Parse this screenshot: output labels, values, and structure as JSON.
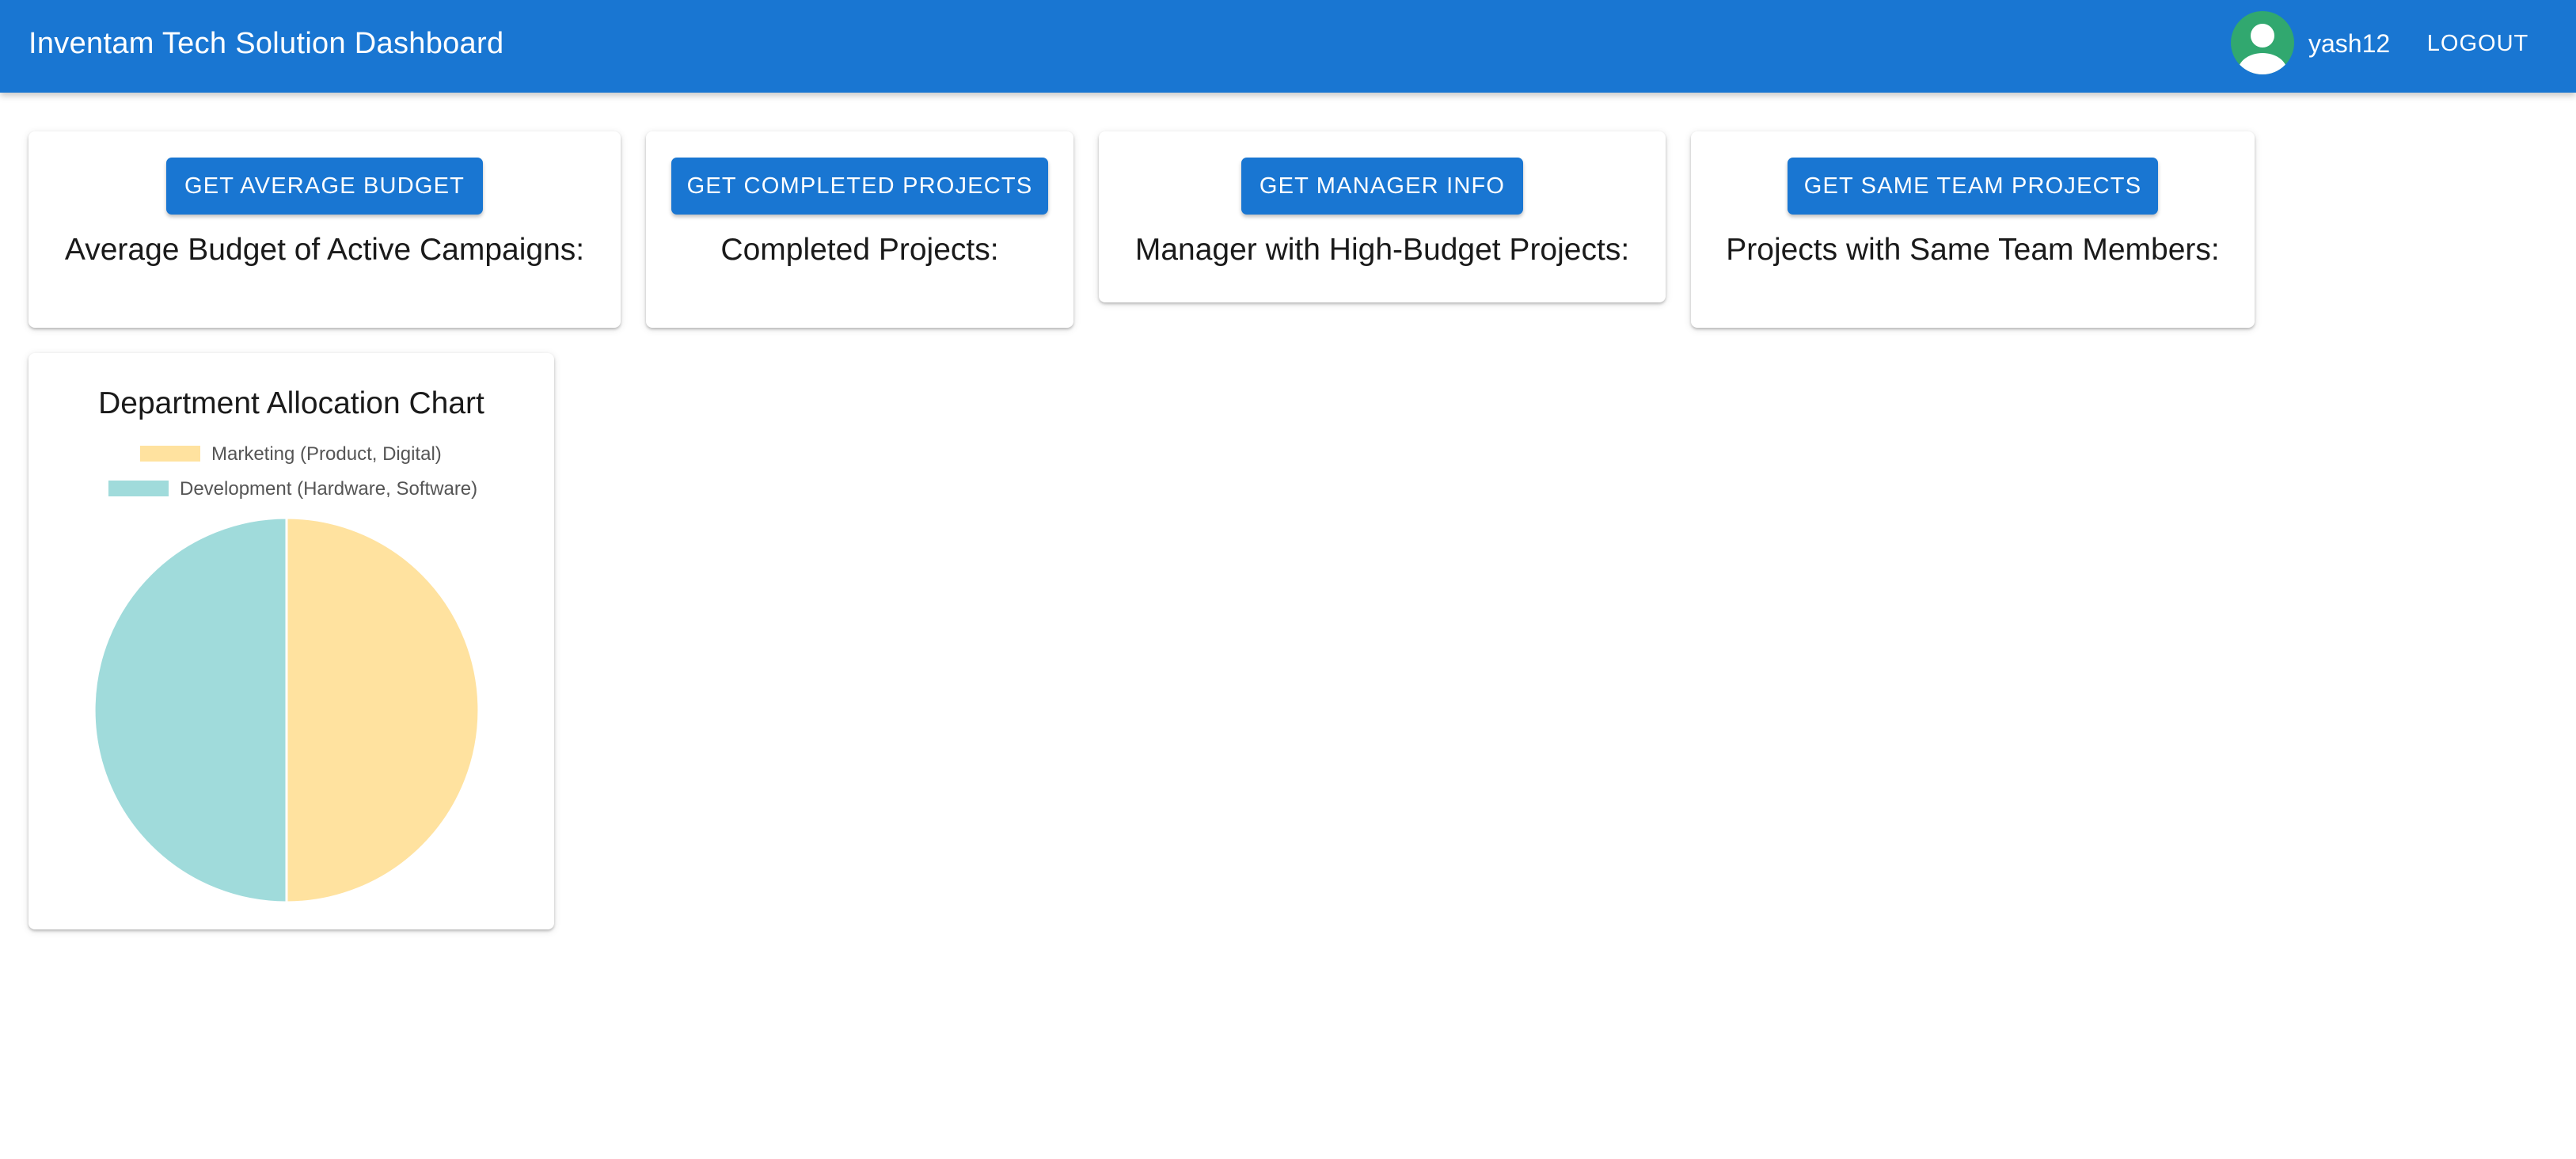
{
  "app_bar": {
    "title": "Inventam Tech Solution Dashboard",
    "username": "yash12",
    "logout_label": "LOGOUT",
    "avatar_icon": "account-circle-icon",
    "brand_color": "#1976d2",
    "avatar_color": "#31a86f"
  },
  "cards": [
    {
      "button_label": "GET AVERAGE BUDGET",
      "result_label": "Average Budget of Active Campaigns:"
    },
    {
      "button_label": "GET COMPLETED PROJECTS",
      "result_label": "Completed Projects:"
    },
    {
      "button_label": "GET MANAGER INFO",
      "result_label": "Manager with High-Budget Projects:"
    },
    {
      "button_label": "GET SAME TEAM PROJECTS",
      "result_label": "Projects with Same Team Members:"
    }
  ],
  "chart_data": {
    "type": "pie",
    "title": "Department Allocation Chart",
    "legend_position": "top",
    "labels": [
      "Marketing (Product, Digital)",
      "Development (Hardware, Software)"
    ],
    "values": [
      50,
      50
    ],
    "colors": [
      "#ffe29f",
      "#a0dbdb"
    ]
  }
}
